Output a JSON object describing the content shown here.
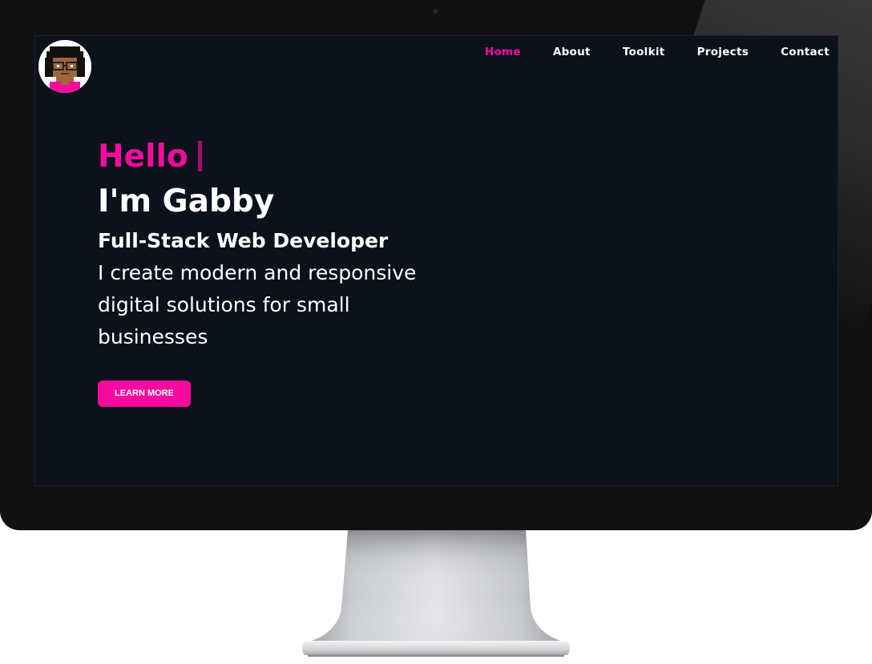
{
  "nav": {
    "items": [
      {
        "label": "Home",
        "active": true
      },
      {
        "label": "About",
        "active": false
      },
      {
        "label": "Toolkit",
        "active": false
      },
      {
        "label": "Projects",
        "active": false
      },
      {
        "label": "Contact",
        "active": false
      }
    ]
  },
  "hero": {
    "greeting": "Hello",
    "name": "I'm Gabby",
    "role": "Full-Stack Web Developer",
    "tagline": "I create modern and responsive digital solutions for small businesses",
    "cta_label": "LEARN MORE"
  },
  "colors": {
    "accent": "#f70aa0",
    "screen_bg": "#0c111c",
    "bezel": "#111112",
    "text": "#ffffff"
  },
  "icons": {
    "avatar": "pixel-avatar-icon",
    "camera": "camera-icon"
  }
}
